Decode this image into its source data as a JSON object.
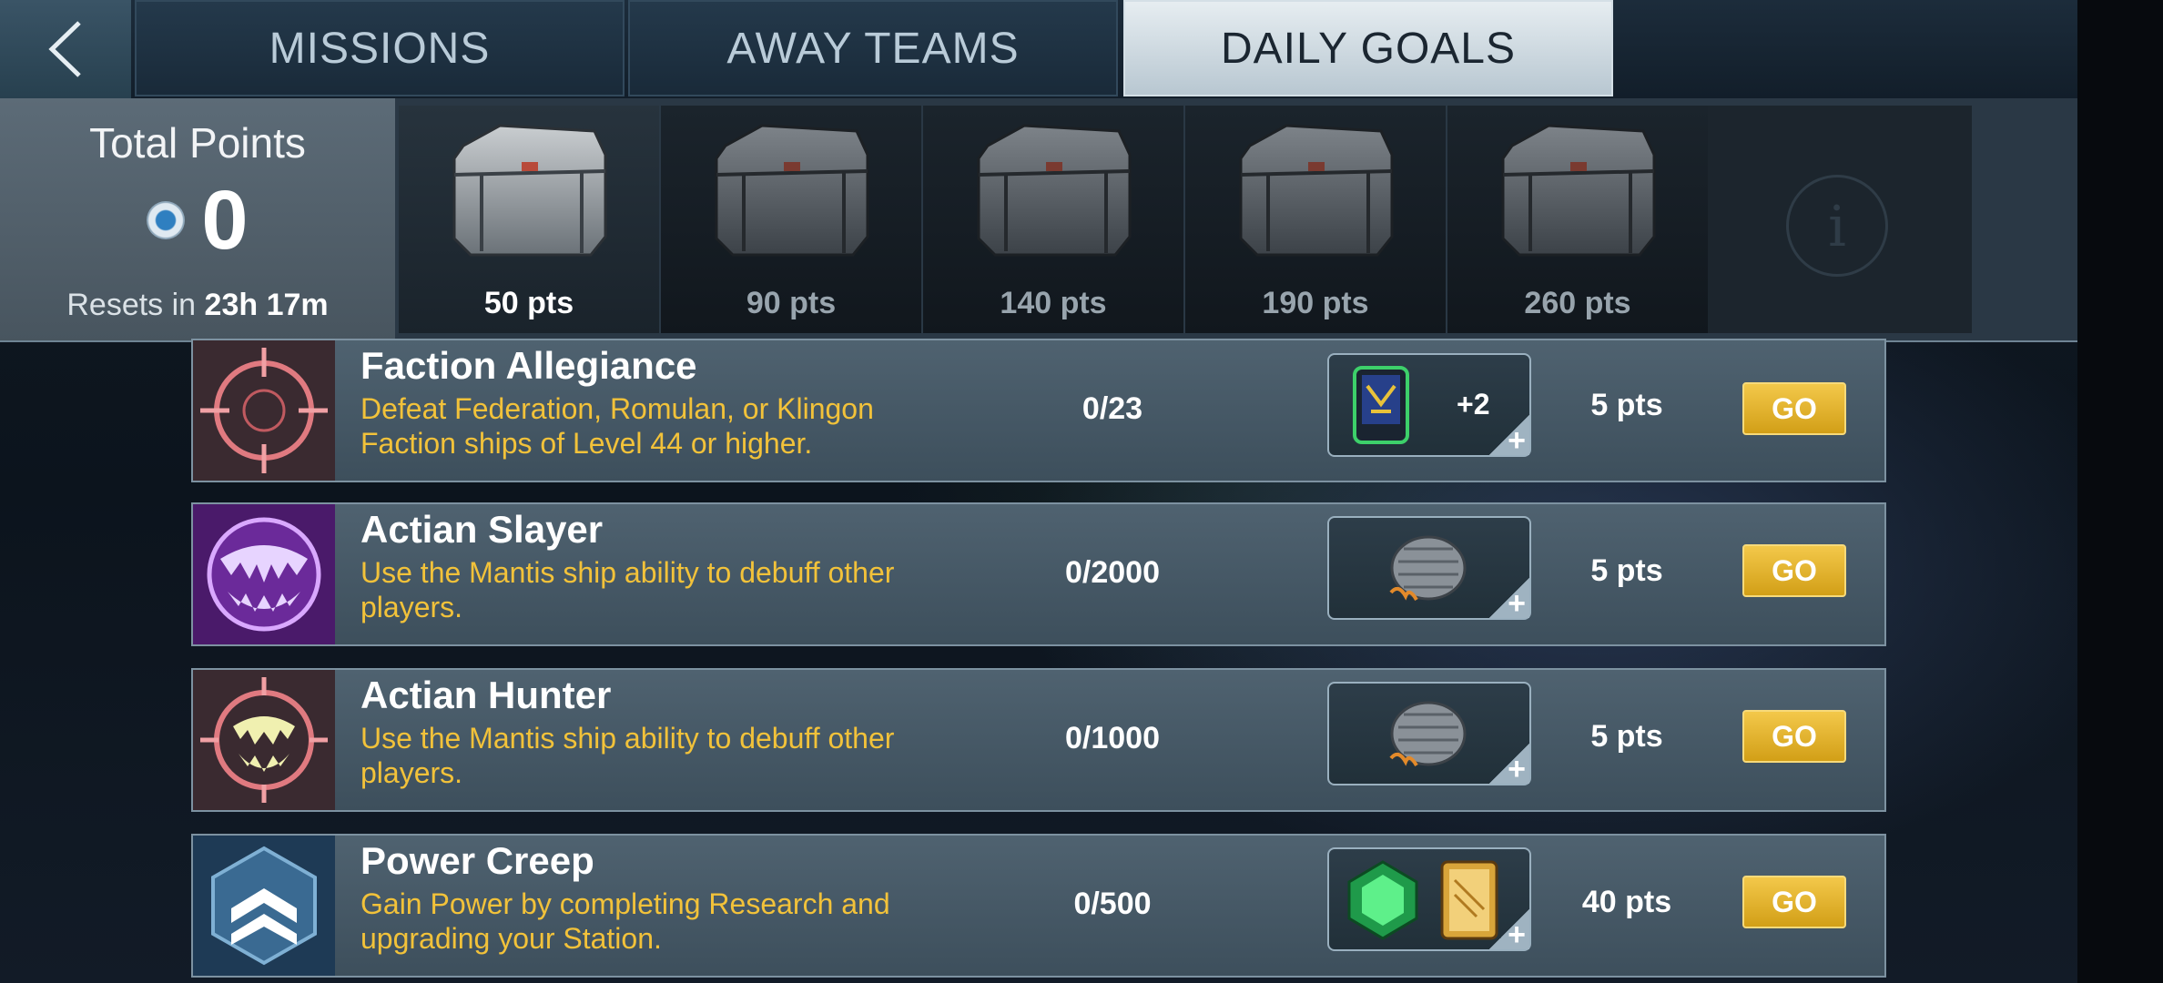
{
  "tabs": [
    {
      "label": "MISSIONS"
    },
    {
      "label": "AWAY TEAMS"
    },
    {
      "label": "DAILY GOALS"
    }
  ],
  "total_points": {
    "title": "Total Points",
    "value": "0",
    "resets_prefix": "Resets in",
    "resets_time": "23h 17m"
  },
  "chests": [
    {
      "label": "50 pts"
    },
    {
      "label": "90 pts"
    },
    {
      "label": "140 pts"
    },
    {
      "label": "190 pts"
    },
    {
      "label": "260 pts"
    }
  ],
  "goals": [
    {
      "title": "Faction Allegiance",
      "description": "Defeat Federation, Romulan, or Klingon Faction ships of Level 44 or higher.",
      "progress": "0/23",
      "reward_extra": "+2",
      "points": "5 pts",
      "button": "GO",
      "icon": "crosshair-icon"
    },
    {
      "title": "Actian Slayer",
      "description": "Use the Mantis ship ability to debuff other players.",
      "progress": "0/2000",
      "points": "5 pts",
      "button": "GO",
      "icon": "purple-fangs-icon"
    },
    {
      "title": "Actian Hunter",
      "description": "Use the Mantis ship ability to debuff other players.",
      "progress": "0/1000",
      "points": "5 pts",
      "button": "GO",
      "icon": "fangs-crosshair-icon"
    },
    {
      "title": "Power Creep",
      "description": "Gain Power by completing Research and upgrading your Station.",
      "progress": "0/500",
      "points": "40 pts",
      "button": "GO",
      "icon": "chevron-rank-icon"
    }
  ],
  "colors": {
    "accent_gold": "#f2c23a",
    "go_button": "#e2b22a",
    "active_tab": "#dfe7ec"
  }
}
